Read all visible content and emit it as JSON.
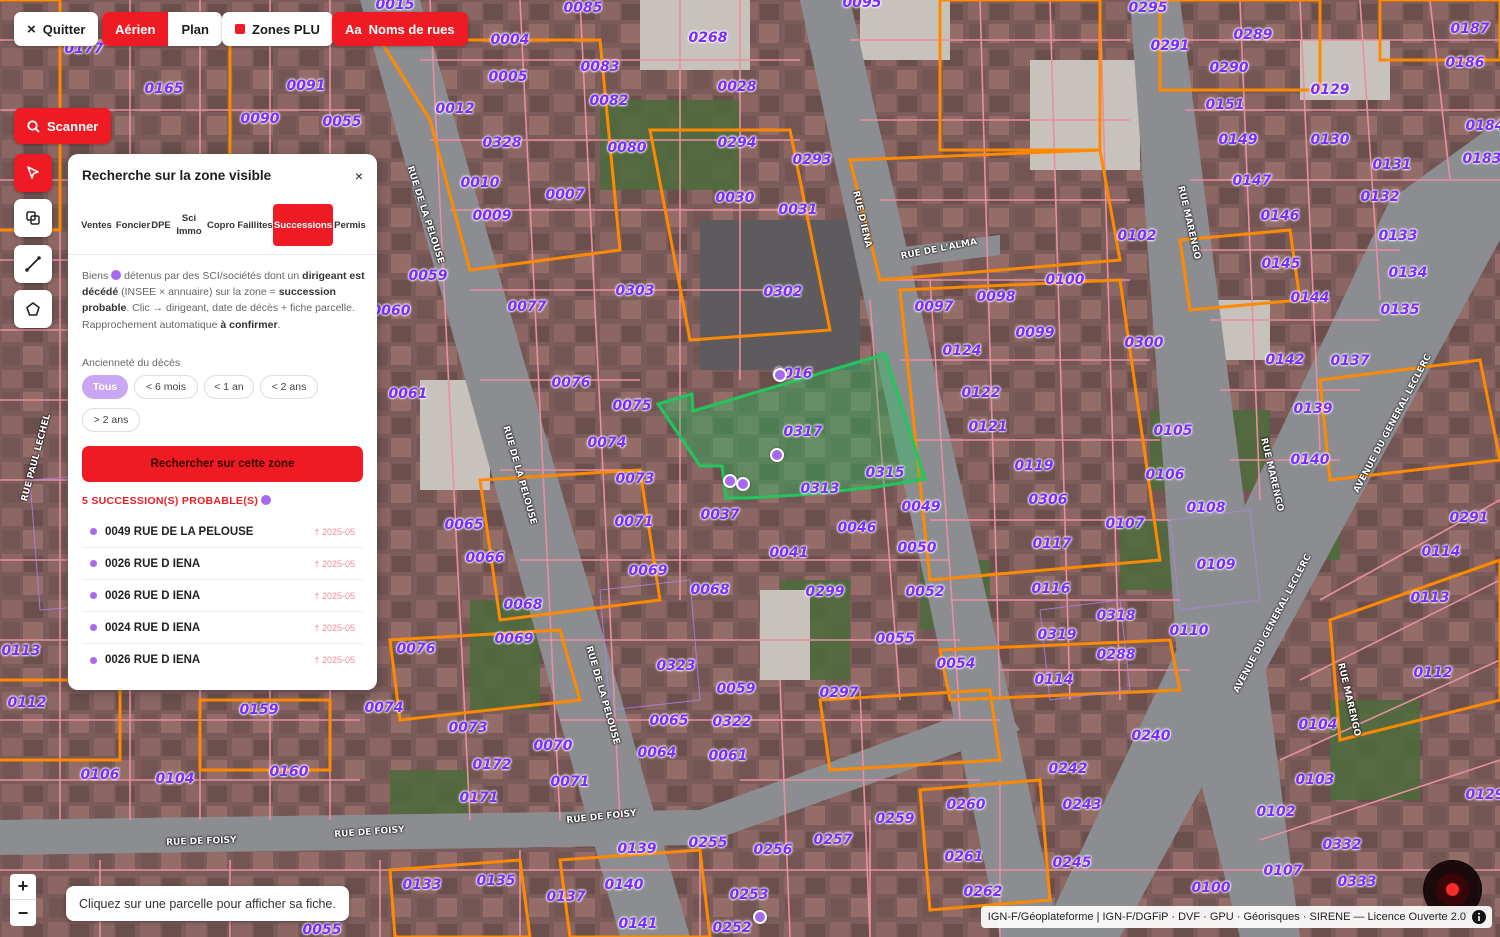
{
  "toolbar": {
    "quit_label": "Quitter",
    "view_modes": [
      "Aérien",
      "Plan"
    ],
    "active_view": "Aérien",
    "zones_label": "Zones PLU",
    "street_names_prefix": "Aa",
    "street_names_label": "Noms de rues",
    "scan_label": "Scanner"
  },
  "tools": [
    "pointer-icon",
    "layers-icon",
    "measure-line-icon",
    "polygon-icon"
  ],
  "panel": {
    "title": "Recherche sur la zone visible",
    "close": "×",
    "tabs": [
      "Ventes",
      "Foncier",
      "DPE",
      "Sci Immo",
      "Copro",
      "Faillites",
      "Successions",
      "Permis"
    ],
    "active_tab": "Successions",
    "desc_1": "Biens",
    "desc_2": "détenus par des SCI/sociétés dont un",
    "desc_3": "dirigeant est décédé",
    "desc_4": "(INSEE × annuaire) sur la zone =",
    "desc_5": "succession probable",
    "desc_6": ". Clic → dirigeant, date de décès + fiche parcelle. Rapprochement automatique",
    "desc_7": "à confirmer",
    "desc_8": ".",
    "filter_label": "Ancienneté du décès",
    "filters": [
      "Tous",
      "< 6 mois",
      "< 1 an",
      "< 2 ans",
      "> 2 ans"
    ],
    "active_filter": "Tous",
    "search_button": "Rechercher sur cette zone",
    "result_count": "5 SUCCESSION(S) PROBABLE(S)",
    "results": [
      {
        "address": "0049 RUE DE LA PELOUSE",
        "date": "† 2025-05"
      },
      {
        "address": "0026 RUE D IENA",
        "date": "† 2025-05"
      },
      {
        "address": "0026 RUE D IENA",
        "date": "† 2025-05"
      },
      {
        "address": "0024 RUE D IENA",
        "date": "† 2025-05"
      },
      {
        "address": "0026 RUE D IENA",
        "date": "† 2025-05"
      }
    ]
  },
  "map": {
    "selected_parcel": "0317",
    "parcel_labels": [
      "0015",
      "0085",
      "0095",
      "0295",
      "0187",
      "0177",
      "0004",
      "0268",
      "0291",
      "0289",
      "0186",
      "0165",
      "0091",
      "0005",
      "0083",
      "0028",
      "0290",
      "0129",
      "0012",
      "0082",
      "0090",
      "0055",
      "0328",
      "0080",
      "0294",
      "0151",
      "0149",
      "0130",
      "0184",
      "0293",
      "0183",
      "0131",
      "0147",
      "0010",
      "0007",
      "0030",
      "0031",
      "0132",
      "0009",
      "0146",
      "0102",
      "0133",
      "0059",
      "0303",
      "0302",
      "0145",
      "0134",
      "0060",
      "0077",
      "0097",
      "0098",
      "0100",
      "0144",
      "0135",
      "0099",
      "0300",
      "0016",
      "0124",
      "0142",
      "0137",
      "0061",
      "0076",
      "0122",
      "0075",
      "0317",
      "0121",
      "0105",
      "0139",
      "0074",
      "0315",
      "0119",
      "0106",
      "0140",
      "0073",
      "0313",
      "0049",
      "0306",
      "0108",
      "0071",
      "0037",
      "0046",
      "0107",
      "0291",
      "0065",
      "0066",
      "0041",
      "0050",
      "0117",
      "0114",
      "0069",
      "0068",
      "0299",
      "0052",
      "0116",
      "0109",
      "0113",
      "0068",
      "0318",
      "0110",
      "0069",
      "0076",
      "0055",
      "0319",
      "0288",
      "0113",
      "0323",
      "0054",
      "0112",
      "0112",
      "0159",
      "0074",
      "0059",
      "0297",
      "0114",
      "0073",
      "0065",
      "0322",
      "0104",
      "0070",
      "0240",
      "0064",
      "0061",
      "0242",
      "0172",
      "0106",
      "0104",
      "0160",
      "0071",
      "0103",
      "0243",
      "0129",
      "0171",
      "0260",
      "0102",
      "0259",
      "0257",
      "0332",
      "0139",
      "0255",
      "0256",
      "0261",
      "0245",
      "0107",
      "0133",
      "0135",
      "0140",
      "0137",
      "0253",
      "0262",
      "0333",
      "0100",
      "0141",
      "0252",
      "0055"
    ],
    "streets": [
      "RUE DE LA PELOUSE",
      "RUE D'IENA",
      "RUE DE L'ALMA",
      "RUE MARENGO",
      "AVENUE DU GENERAL LECLERC",
      "RUE DE FOISY",
      "RUE PAUL LECHEL"
    ]
  },
  "hint": "Cliquez sur une parcelle pour afficher sa fiche.",
  "zoom": {
    "in": "+",
    "out": "−"
  },
  "attribution": "IGN-F/Géoplateforme | IGN-F/DGFiP · DVF · GPU · Géorisques · SIRENE — Licence Ouverte 2.0",
  "colors": {
    "accent": "#ee1b24",
    "succession": "#a768f0",
    "parcel_border": "#e88fa0",
    "zone_border": "#ff8a00",
    "selection": "#22c55e"
  }
}
